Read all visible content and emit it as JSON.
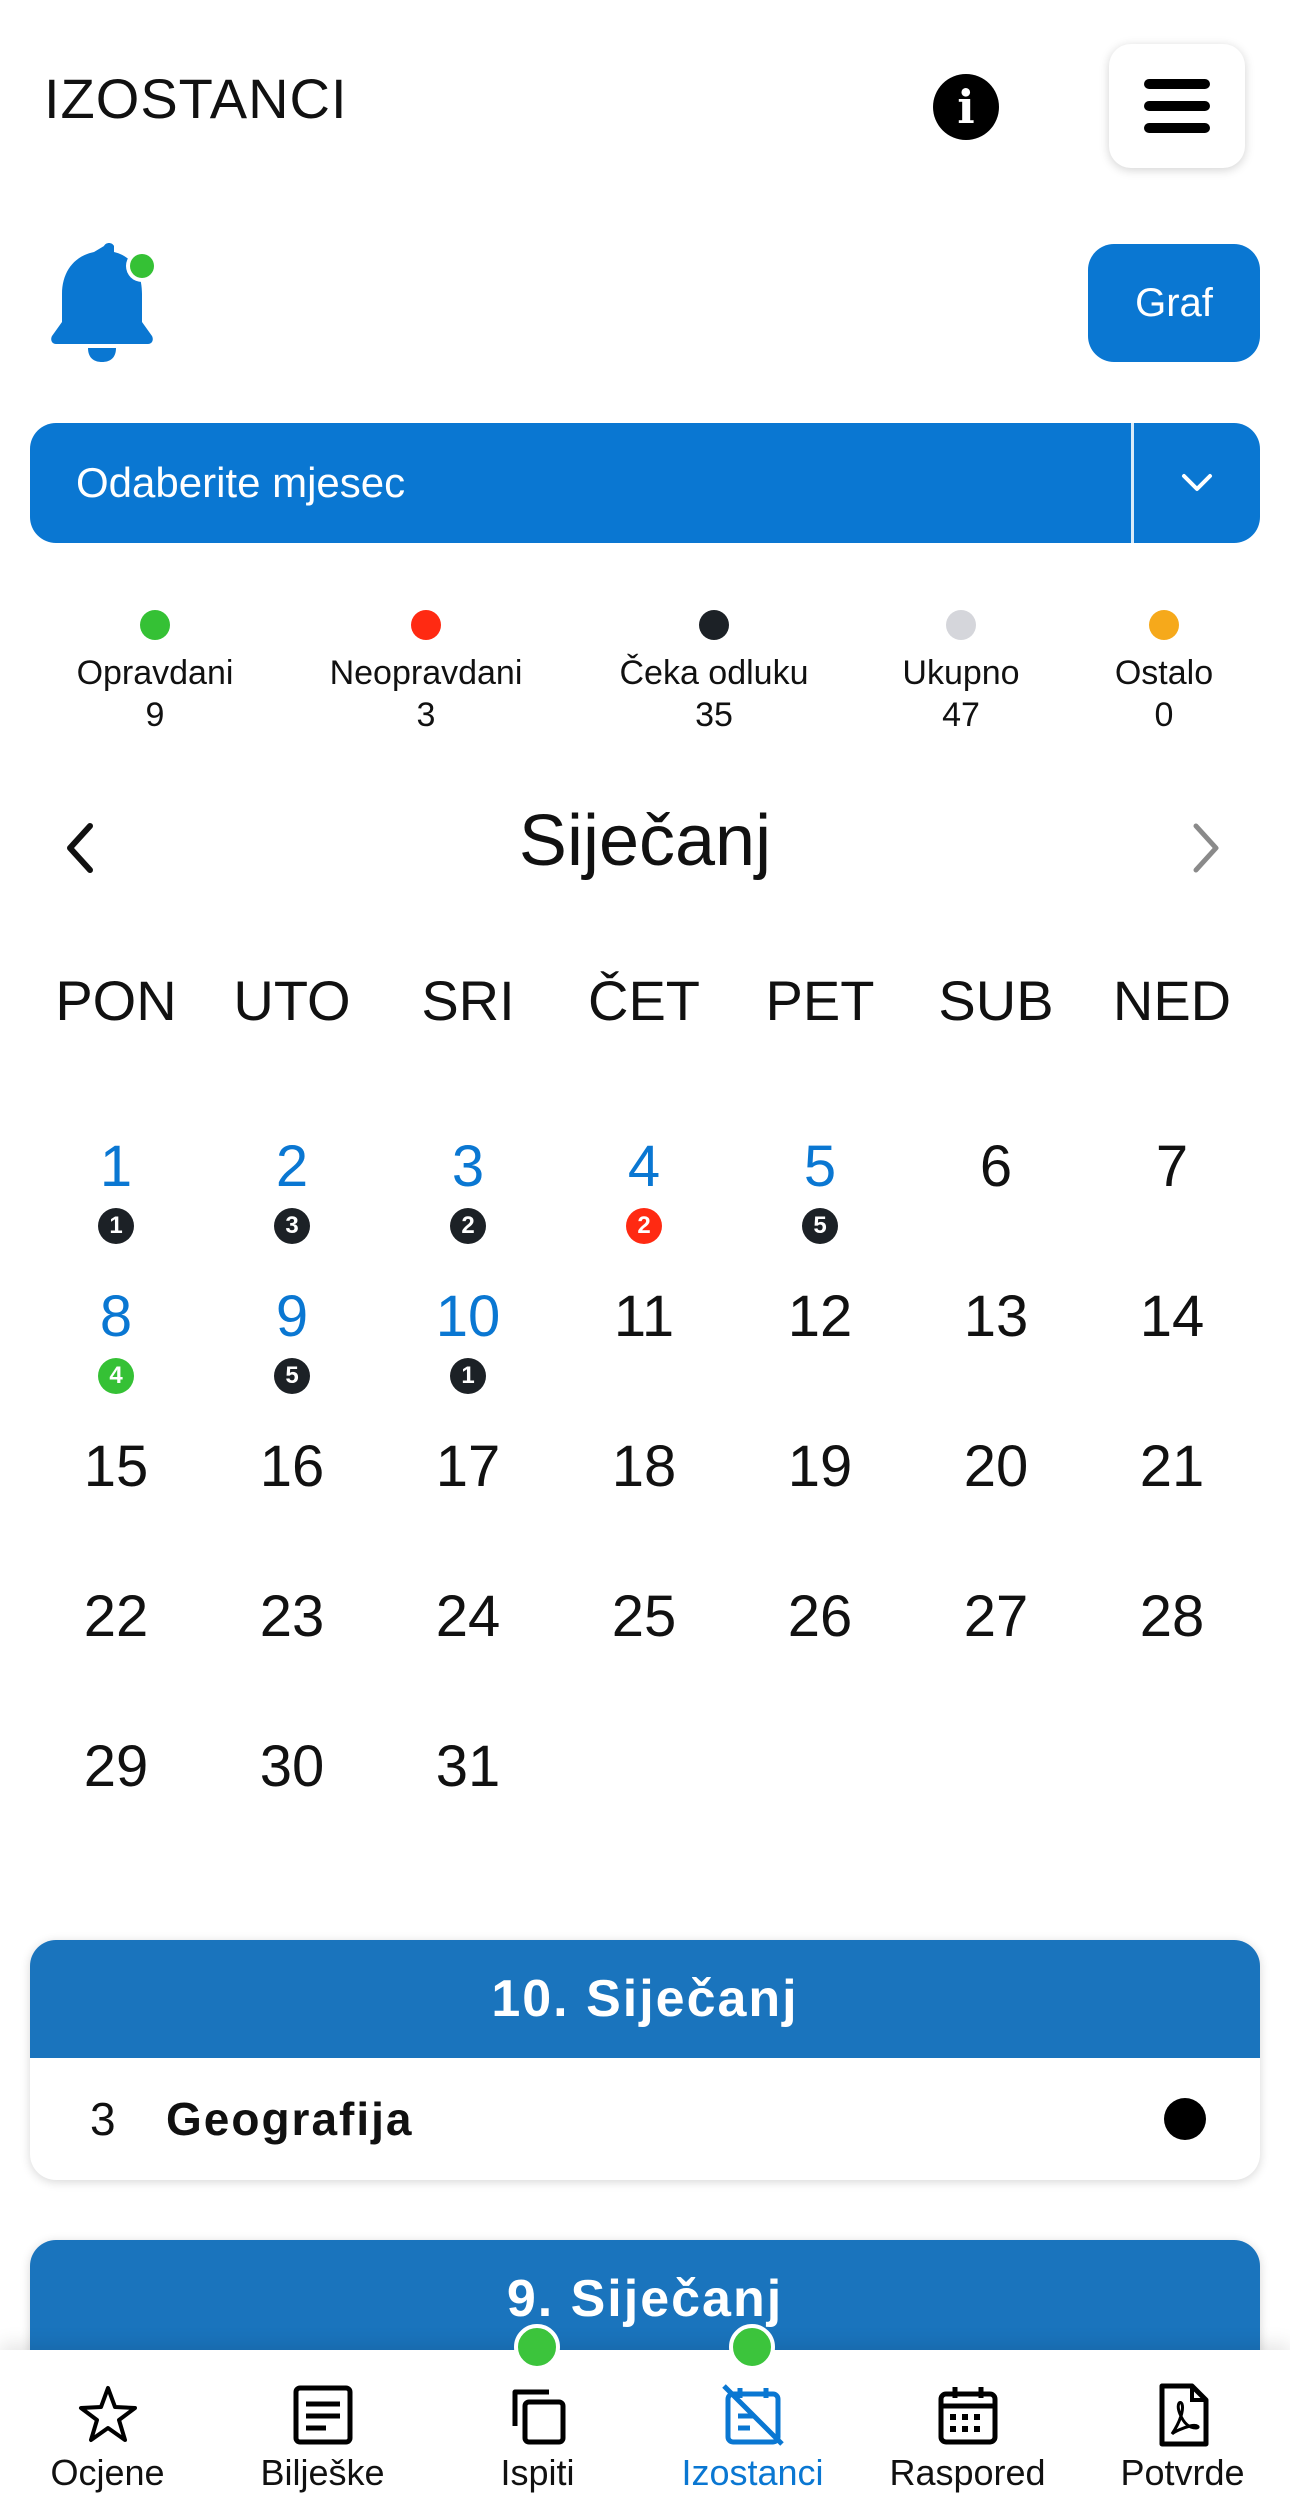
{
  "header": {
    "title": "IZOSTANCI",
    "info_icon": "info-icon",
    "menu_icon": "hamburger-menu-icon"
  },
  "toolbar": {
    "graf_label": "Graf",
    "bell_icon": "bell-icon"
  },
  "month_select": {
    "label": "Odaberite mjesec",
    "icon": "chevron-down-icon"
  },
  "legend": [
    {
      "label": "Opravdani",
      "count": "9",
      "color": "#35c135"
    },
    {
      "label": "Neopravdani",
      "count": "3",
      "color": "#ff2a12"
    },
    {
      "label": "Čeka odluku",
      "count": "35",
      "color": "#1c2126"
    },
    {
      "label": "Ukupno",
      "count": "47",
      "color": "#d5d6db"
    },
    {
      "label": "Ostalo",
      "count": "0",
      "color": "#f6a91b"
    }
  ],
  "calendar": {
    "month": "Siječanj",
    "weekdays": [
      "PON",
      "UTO",
      "SRI",
      "ČET",
      "PET",
      "SUB",
      "NED"
    ],
    "weeks": [
      [
        {
          "d": "1",
          "b": "1",
          "c": "dark"
        },
        {
          "d": "2",
          "b": "3",
          "c": "dark"
        },
        {
          "d": "3",
          "b": "2",
          "c": "dark"
        },
        {
          "d": "4",
          "b": "2",
          "c": "red"
        },
        {
          "d": "5",
          "b": "5",
          "c": "dark"
        },
        {
          "d": "6"
        },
        {
          "d": "7"
        }
      ],
      [
        {
          "d": "8",
          "b": "4",
          "c": "green"
        },
        {
          "d": "9",
          "b": "5",
          "c": "dark"
        },
        {
          "d": "10",
          "b": "1",
          "c": "dark"
        },
        {
          "d": "11"
        },
        {
          "d": "12"
        },
        {
          "d": "13"
        },
        {
          "d": "14"
        }
      ],
      [
        {
          "d": "15"
        },
        {
          "d": "16"
        },
        {
          "d": "17"
        },
        {
          "d": "18"
        },
        {
          "d": "19"
        },
        {
          "d": "20"
        },
        {
          "d": "21"
        }
      ],
      [
        {
          "d": "22"
        },
        {
          "d": "23"
        },
        {
          "d": "24"
        },
        {
          "d": "25"
        },
        {
          "d": "26"
        },
        {
          "d": "27"
        },
        {
          "d": "28"
        }
      ],
      [
        {
          "d": "29"
        },
        {
          "d": "30"
        },
        {
          "d": "31"
        }
      ]
    ]
  },
  "badge_colors": {
    "dark": "#1c2126",
    "red": "#ff2a12",
    "green": "#35c135"
  },
  "day_cards": [
    {
      "title": "10. Siječanj",
      "rows": [
        {
          "period": "3",
          "subject": "Geografija",
          "status_color": "#000000"
        }
      ]
    },
    {
      "title": "9. Siječanj",
      "rows": []
    }
  ],
  "bottom_nav": [
    {
      "label": "Ocjene",
      "icon": "star-icon",
      "active": false,
      "dot": false
    },
    {
      "label": "Bilješke",
      "icon": "notes-icon",
      "active": false,
      "dot": false
    },
    {
      "label": "Ispiti",
      "icon": "copy-icon",
      "active": false,
      "dot": true
    },
    {
      "label": "Izostanci",
      "icon": "calendar-off-icon",
      "active": true,
      "dot": true
    },
    {
      "label": "Raspored",
      "icon": "calendar-icon",
      "active": false,
      "dot": false
    },
    {
      "label": "Potvrde",
      "icon": "pdf-icon",
      "active": false,
      "dot": false
    }
  ]
}
